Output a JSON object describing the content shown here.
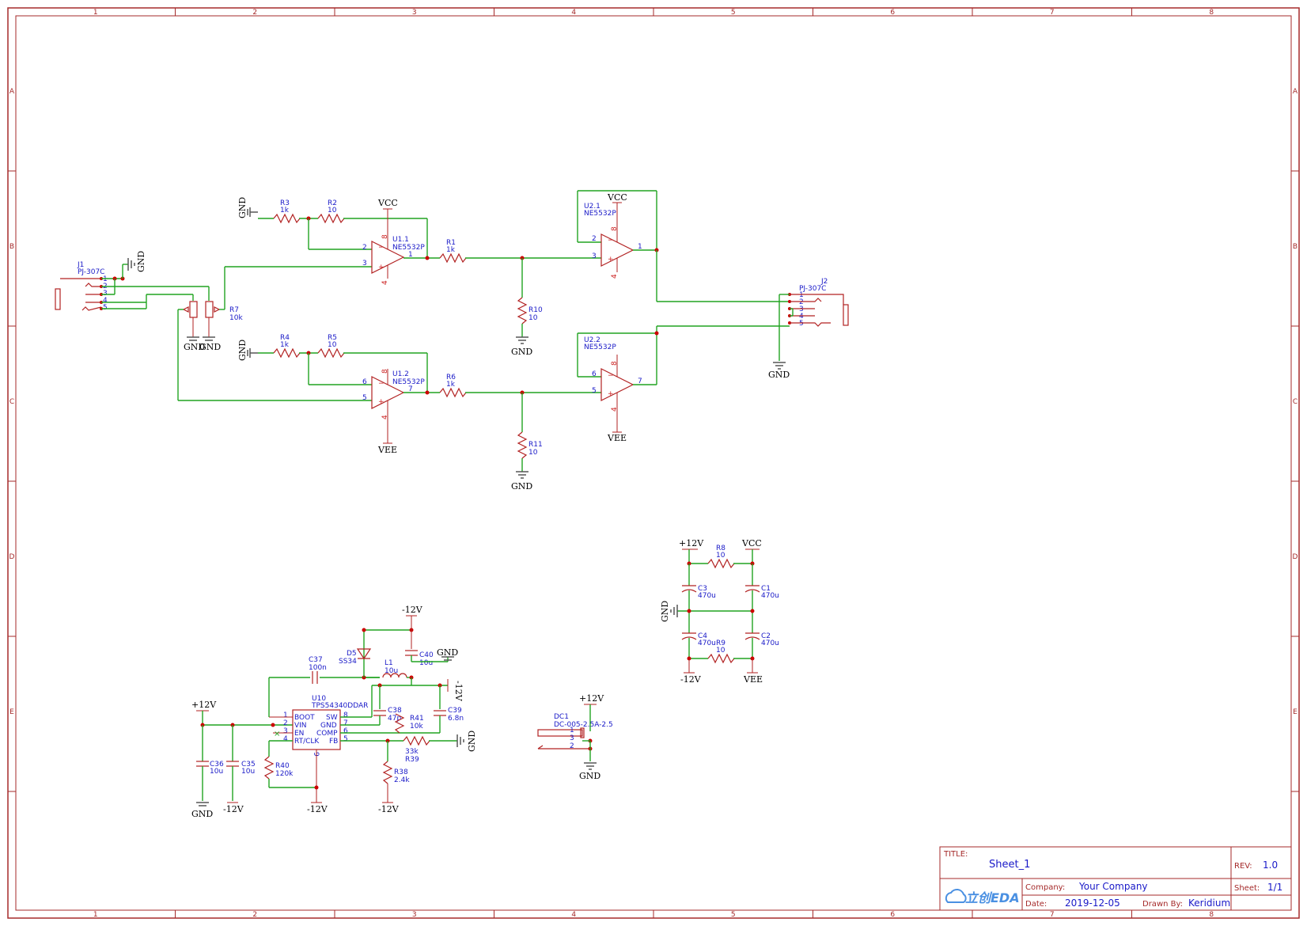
{
  "zones": {
    "columns": [
      "1",
      "2",
      "3",
      "4",
      "5",
      "6",
      "7",
      "8"
    ],
    "rows": [
      "A",
      "B",
      "C",
      "D",
      "E"
    ]
  },
  "nets": {
    "gnd": "GND",
    "vcc": "VCC",
    "vee": "VEE",
    "p12": "+12V",
    "m12": "-12V"
  },
  "components": {
    "R3": {
      "ref": "R3",
      "val": "1k"
    },
    "R2": {
      "ref": "R2",
      "val": "10"
    },
    "R4": {
      "ref": "R4",
      "val": "1k"
    },
    "R5": {
      "ref": "R5",
      "val": "10"
    },
    "R1": {
      "ref": "R1",
      "val": "1k"
    },
    "R6": {
      "ref": "R6",
      "val": "1k"
    },
    "R10": {
      "ref": "R10",
      "val": "10"
    },
    "R11": {
      "ref": "R11",
      "val": "10"
    },
    "R7": {
      "ref": "R7",
      "val": "10k"
    },
    "R8": {
      "ref": "R8",
      "val": "10"
    },
    "R9": {
      "ref": "R9",
      "val": "10"
    },
    "R40": {
      "ref": "R40",
      "val": "120k"
    },
    "R41": {
      "ref": "R41",
      "val": "10k"
    },
    "R39": {
      "ref": "R39",
      "val": "33k"
    },
    "R38": {
      "ref": "R38",
      "val": "2.4k"
    },
    "U11": {
      "ref": "U1.1",
      "val": "NE5532P"
    },
    "U12": {
      "ref": "U1.2",
      "val": "NE5532P"
    },
    "U21": {
      "ref": "U2.1",
      "val": "NE5532P"
    },
    "U22": {
      "ref": "U2.2",
      "val": "NE5532P"
    },
    "J1": {
      "ref": "J1",
      "val": "PJ-307C"
    },
    "J2": {
      "ref": "J2",
      "val": "PJ-307C"
    },
    "C1": {
      "ref": "C1",
      "val": "470u"
    },
    "C2": {
      "ref": "C2",
      "val": "470u"
    },
    "C3": {
      "ref": "C3",
      "val": "470u"
    },
    "C4": {
      "ref": "C4",
      "val": "470u"
    },
    "C35": {
      "ref": "C35",
      "val": "10u"
    },
    "C36": {
      "ref": "C36",
      "val": "10u"
    },
    "C37": {
      "ref": "C37",
      "val": "100n"
    },
    "C38": {
      "ref": "C38",
      "val": "47p"
    },
    "C39": {
      "ref": "C39",
      "val": "6.8n"
    },
    "C40": {
      "ref": "C40",
      "val": "10u"
    },
    "D5": {
      "ref": "D5",
      "val": "SS34"
    },
    "L1": {
      "ref": "L1",
      "val": "10u"
    },
    "U10": {
      "ref": "U10",
      "val": "TPS54340DDAR"
    },
    "DC1": {
      "ref": "DC1",
      "val": "DC-005-2.5A-2.5"
    }
  },
  "u10_pins": [
    "BOOT",
    "VIN",
    "EN",
    "RT/CLK",
    "SW",
    "GND",
    "COMP",
    "FB"
  ],
  "titleblock": {
    "title_label": "TITLE:",
    "title": "Sheet_1",
    "rev_label": "REV:",
    "rev": "1.0",
    "company_label": "Company:",
    "company": "Your Company",
    "sheet_label": "Sheet:",
    "sheet": "1/1",
    "date_label": "Date:",
    "date": "2019-12-05",
    "drawn_label": "Drawn By:",
    "drawn": "Keridium",
    "logo_text": "立创EDA"
  }
}
